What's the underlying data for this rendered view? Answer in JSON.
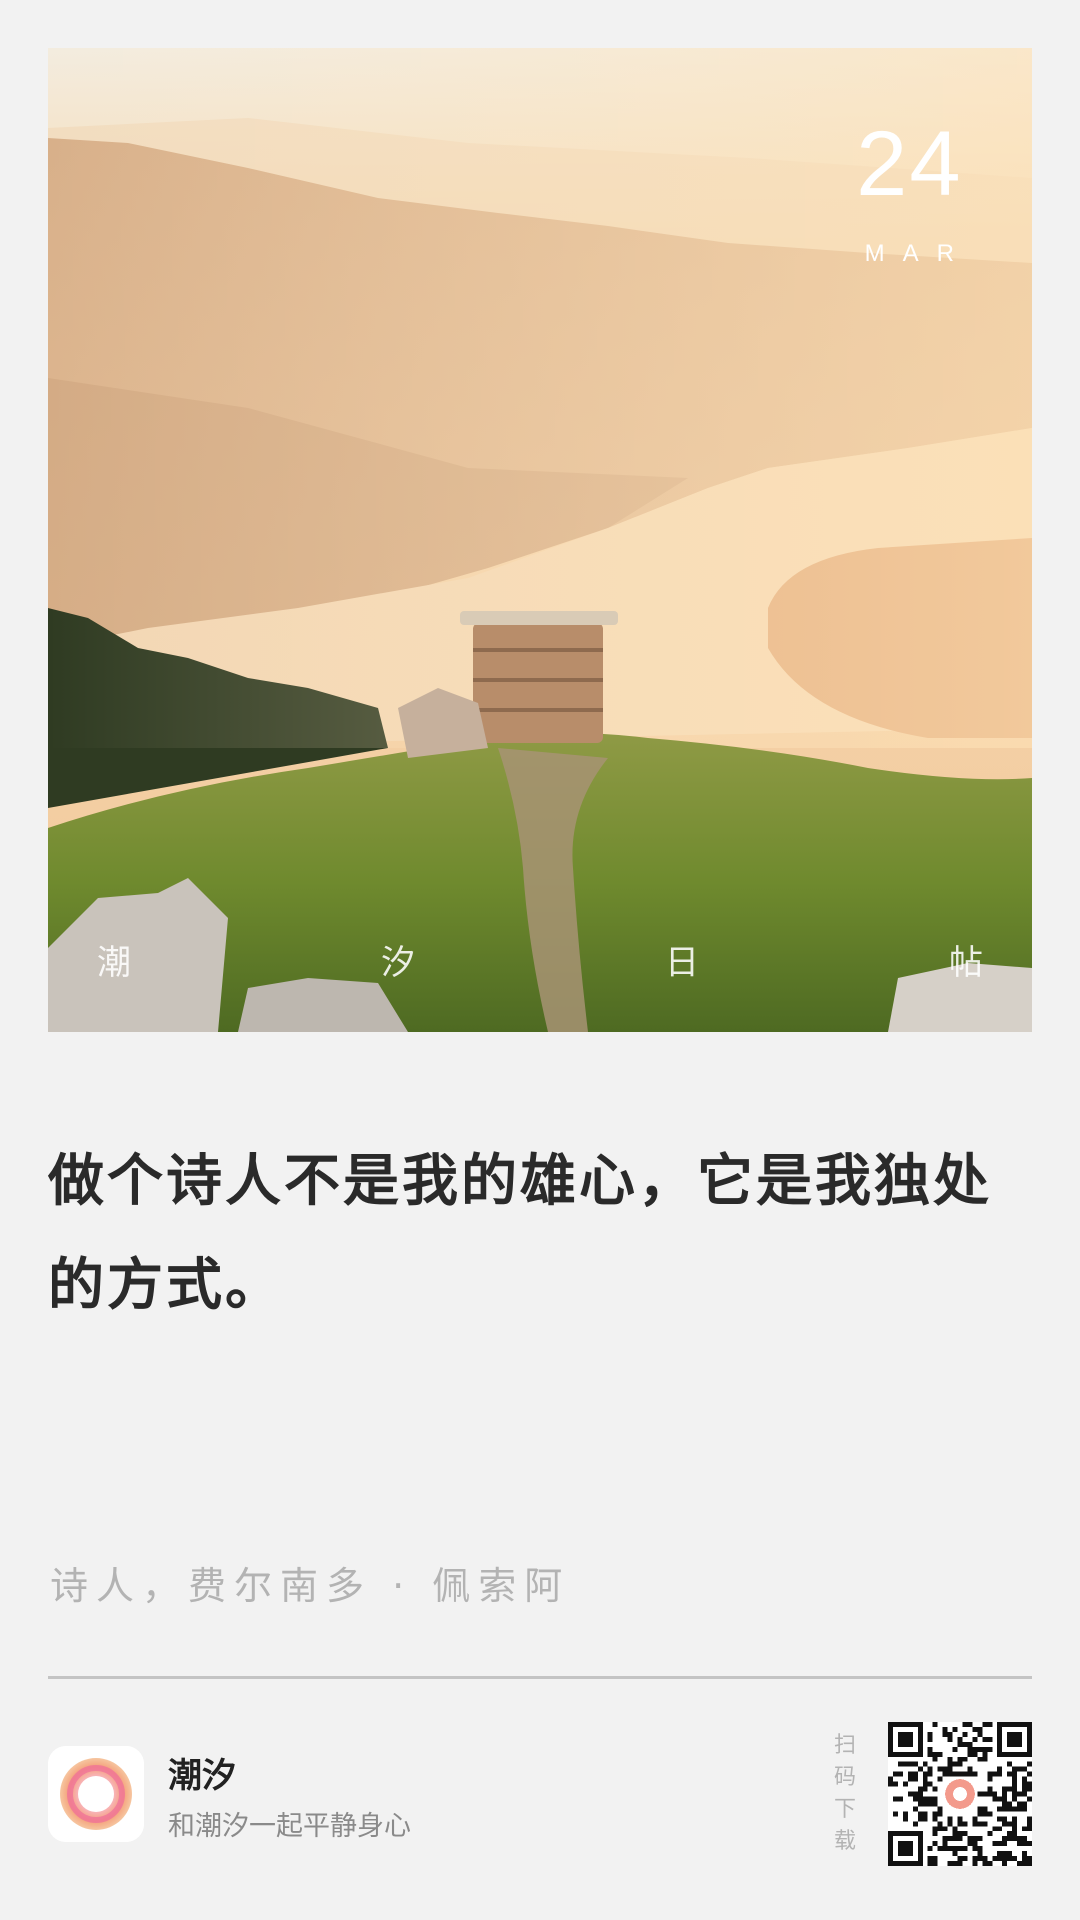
{
  "card": {
    "date_day": "24",
    "date_month": "MAR",
    "brand_chars": [
      "潮",
      "汐",
      "日",
      "帖"
    ]
  },
  "quote": {
    "text": "做个诗人不是我的雄心，它是我独处的方式。",
    "author": "诗人，费尔南多 · 佩索阿"
  },
  "footer": {
    "app_name": "潮汐",
    "slogan": "和潮汐一起平静身心",
    "scan_text": "扫码下载"
  },
  "icons": {
    "app_logo": "tide-app-logo",
    "qr": "qr-code-icon"
  },
  "colors": {
    "background": "#f2f2f2",
    "quote_text": "#2a2a2a",
    "secondary_text": "#b3b3b3",
    "logo_gradient_start": "#f7a96a",
    "logo_gradient_end": "#f06c9b"
  }
}
